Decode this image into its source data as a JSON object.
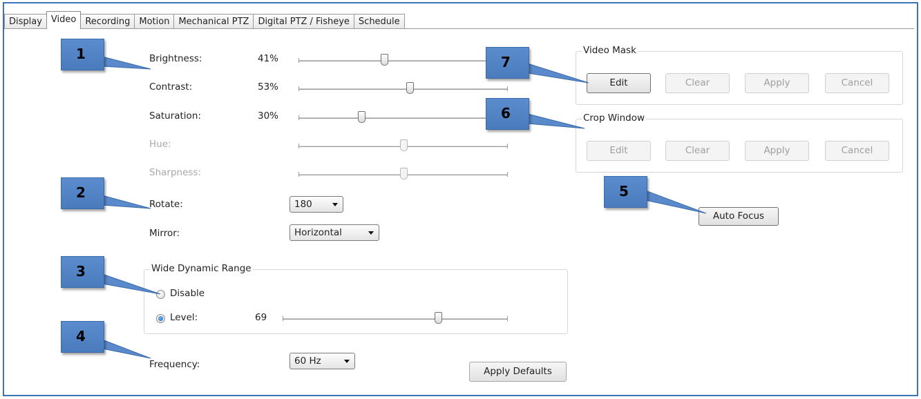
{
  "tabs": [
    {
      "label": "Display"
    },
    {
      "label": "Video"
    },
    {
      "label": "Recording"
    },
    {
      "label": "Motion"
    },
    {
      "label": "Mechanical PTZ"
    },
    {
      "label": "Digital PTZ / Fisheye"
    },
    {
      "label": "Schedule"
    }
  ],
  "image": {
    "brightness": {
      "label": "Brightness:",
      "value_text": "41%",
      "value": 0.41
    },
    "contrast": {
      "label": "Contrast:",
      "value_text": "53%",
      "value": 0.53
    },
    "saturation": {
      "label": "Saturation:",
      "value_text": "30%",
      "value": 0.3
    },
    "hue": {
      "label": "Hue:",
      "value": 0.5
    },
    "sharpness": {
      "label": "Sharpness:",
      "value": 0.5
    }
  },
  "rotate": {
    "label": "Rotate:",
    "selected": "180"
  },
  "mirror": {
    "label": "Mirror:",
    "selected": "Horizontal"
  },
  "wdr": {
    "title": "Wide Dynamic Range",
    "disable_label": "Disable",
    "level_label": "Level:",
    "level_value_text": "69",
    "level_value": 0.69,
    "selected": "level"
  },
  "frequency": {
    "label": "Frequency:",
    "selected": "60 Hz"
  },
  "apply_defaults_label": "Apply Defaults",
  "video_mask": {
    "title": "Video Mask",
    "edit": "Edit",
    "clear": "Clear",
    "apply": "Apply",
    "cancel": "Cancel"
  },
  "crop_window": {
    "title": "Crop Window",
    "edit": "Edit",
    "clear": "Clear",
    "apply": "Apply",
    "cancel": "Cancel"
  },
  "auto_focus_label": "Auto Focus",
  "callouts": [
    "1",
    "2",
    "3",
    "4",
    "5",
    "6",
    "7"
  ],
  "colors": {
    "frame": "#3b73b9",
    "callout": "#4f80c0",
    "radio_on": "#1d5fa8"
  }
}
